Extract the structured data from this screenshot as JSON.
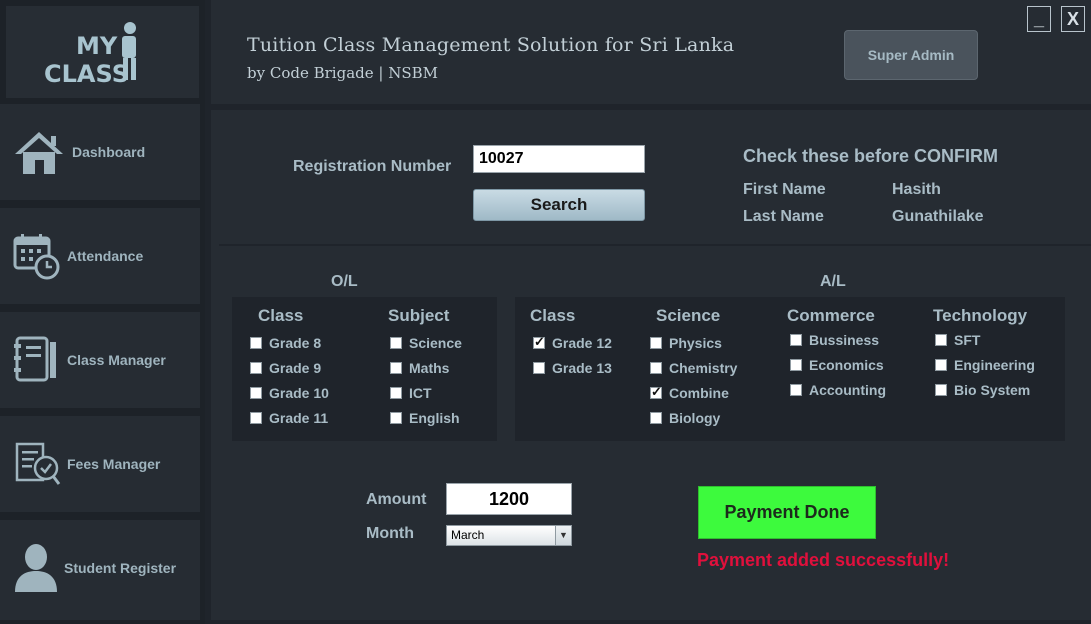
{
  "window": {
    "minimize_label": "_",
    "close_label": "X"
  },
  "logo": {
    "line1": "MY",
    "line2": "CLASS"
  },
  "sidebar": {
    "items": [
      {
        "label": "Dashboard",
        "icon": "home-icon"
      },
      {
        "label": "Attendance",
        "icon": "calendar-clock-icon"
      },
      {
        "label": "Class Manager",
        "icon": "notebook-icon"
      },
      {
        "label": "Fees Manager",
        "icon": "receipt-check-icon"
      },
      {
        "label": "Student Register",
        "icon": "user-icon"
      }
    ]
  },
  "header": {
    "title": "Tuition Class Management Solution for Sri Lanka",
    "subtitle": "by Code Brigade | NSBM",
    "user_button": "Super Admin"
  },
  "search": {
    "label": "Registration Number",
    "value": "10027",
    "button": "Search"
  },
  "confirm": {
    "heading": "Check these before CONFIRM",
    "first_name_label": "First Name",
    "first_name_value": "Hasith",
    "last_name_label": "Last Name",
    "last_name_value": "Gunathilake"
  },
  "ol": {
    "title": "O/L",
    "class_header": "Class",
    "subject_header": "Subject",
    "classes": [
      {
        "label": "Grade 8",
        "checked": false
      },
      {
        "label": "Grade 9",
        "checked": false
      },
      {
        "label": "Grade 10",
        "checked": false
      },
      {
        "label": "Grade 11",
        "checked": false
      }
    ],
    "subjects": [
      {
        "label": "Science",
        "checked": false
      },
      {
        "label": "Maths",
        "checked": false
      },
      {
        "label": "ICT",
        "checked": false
      },
      {
        "label": "English",
        "checked": false
      }
    ]
  },
  "al": {
    "title": "A/L",
    "class_header": "Class",
    "science_header": "Science",
    "commerce_header": "Commerce",
    "technology_header": "Technology",
    "classes": [
      {
        "label": "Grade 12",
        "checked": true
      },
      {
        "label": "Grade 13",
        "checked": false
      }
    ],
    "science": [
      {
        "label": "Physics",
        "checked": false
      },
      {
        "label": "Chemistry",
        "checked": false
      },
      {
        "label": "Combine",
        "checked": true
      },
      {
        "label": "Biology",
        "checked": false
      }
    ],
    "commerce": [
      {
        "label": "Bussiness",
        "checked": false
      },
      {
        "label": "Economics",
        "checked": false
      },
      {
        "label": "Accounting",
        "checked": false
      }
    ],
    "technology": [
      {
        "label": "SFT",
        "checked": false
      },
      {
        "label": "Engineering",
        "checked": false
      },
      {
        "label": "Bio System",
        "checked": false
      }
    ]
  },
  "payment": {
    "amount_label": "Amount",
    "amount_value": "1200",
    "month_label": "Month",
    "month_value": "March",
    "button": "Payment Done",
    "status": "Payment added successfully!",
    "status_color": "#e0103c",
    "button_color": "#3dfa3d"
  }
}
